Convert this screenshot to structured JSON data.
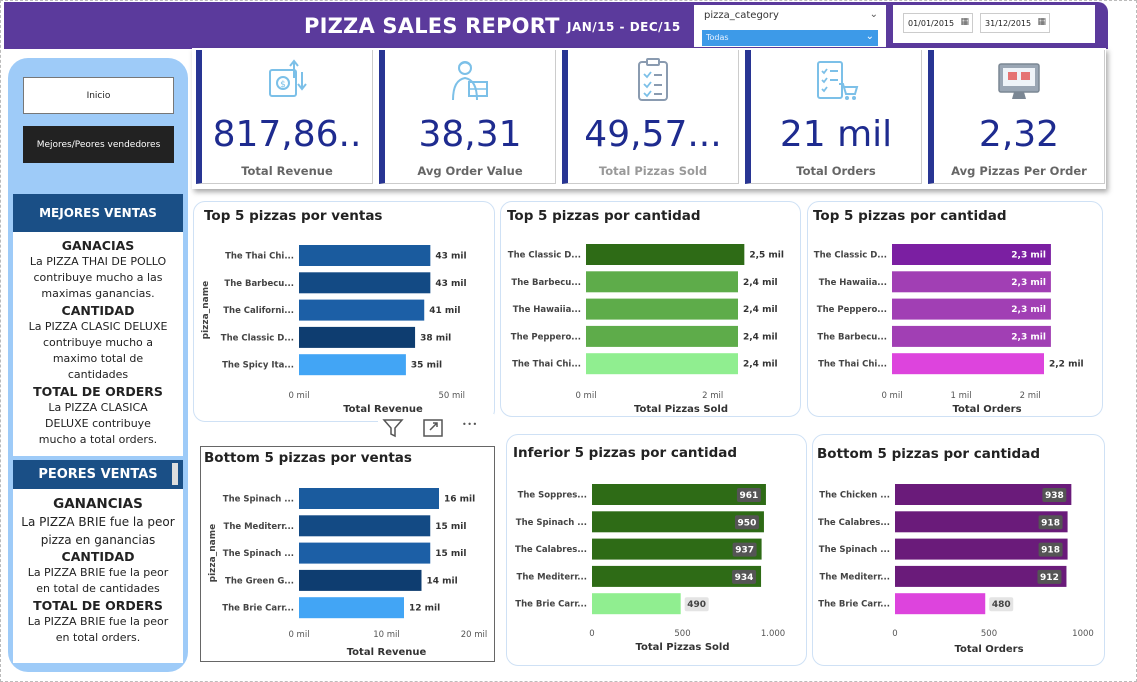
{
  "header": {
    "title": "PIZZA SALES REPORT",
    "period": "JAN/15  -  DEC/15",
    "category_slicer": {
      "label": "pizza_category",
      "selected": "Todas"
    },
    "date_range": {
      "start": "01/01/2015",
      "end": "31/12/2015"
    }
  },
  "sidebar": {
    "buttons": {
      "inicio": "Inicio",
      "mejores": "Mejores/Peores vendedores"
    },
    "mejores": {
      "heading": "MEJORES VENTAS",
      "ganancias_h": "GANACIAS",
      "ganancias_t": "La PIZZA THAI DE POLLO contribuye mucho a las maximas ganancias.",
      "cantidad_h": "CANTIDAD",
      "cantidad_t": "La PIZZA CLASIC DELUXE contribuye mucho a maximo total de cantidades",
      "orders_h": "TOTAL DE ORDERS",
      "orders_t": "La PIZZA CLASICA DELUXE contribuye mucho a total orders."
    },
    "peores": {
      "heading": "PEORES VENTAS",
      "ganancias_h": "GANANCIAS",
      "ganancias_t": "La PIZZA BRIE fue la peor pizza en ganancias",
      "cantidad_h": "CANTIDAD",
      "cantidad_t": "La PIZZA BRIE fue la peor en total de cantidades",
      "orders_h": "TOTAL DE ORDERS",
      "orders_t": "La PIZZA BRIE fue la peor en total orders."
    }
  },
  "kpis": [
    {
      "value": "817,86..",
      "label": "Total Revenue",
      "icon": "money-transfer-icon"
    },
    {
      "value": "38,31",
      "label": "Avg Order Value",
      "icon": "delivery-person-icon"
    },
    {
      "value": "49,57...",
      "label": "Total Pizzas Sold",
      "icon": "clipboard-checklist-icon"
    },
    {
      "value": "21 mil",
      "label": "Total Orders",
      "icon": "checklist-cart-icon"
    },
    {
      "value": "2,32",
      "label": "Avg Pizzas Per Order",
      "icon": "monitor-cart-icon"
    }
  ],
  "toolbar": {
    "icons": [
      "filter-icon",
      "focus-mode-icon",
      "more-options-icon"
    ],
    "more": "• • •"
  },
  "colors": {
    "header": "#5b3a9c",
    "sidebar": "#9ecbf8",
    "side_head": "#1a4f86",
    "kpi_value": "#1e2b8f",
    "kpi_border": "#283593"
  },
  "chart_data": [
    {
      "id": "top-revenue",
      "type": "bar",
      "title": "Top 5 pizzas por ventas",
      "categories": [
        "The Thai Chi...",
        "The Barbecu...",
        "The Californi...",
        "The Classic D...",
        "The Spicy Ita..."
      ],
      "values": [
        43,
        43,
        41,
        38,
        35
      ],
      "labels": [
        "43 mil",
        "43 mil",
        "41 mil",
        "38 mil",
        "35 mil"
      ],
      "colors": [
        "#1a5b9e",
        "#134a84",
        "#1c5fa6",
        "#0e3d70",
        "#42a5f5"
      ],
      "xlabel": "Total Revenue",
      "ylabel": "pizza_name",
      "xlim": [
        0,
        55
      ],
      "ticks": [
        0,
        50
      ],
      "tick_labels": [
        "0 mil",
        "50 mil"
      ],
      "label_style": "outside"
    },
    {
      "id": "top-qty",
      "type": "bar",
      "title": "Top 5 pizzas por cantidad",
      "categories": [
        "The Classic D...",
        "The Barbecu...",
        "The Hawaiia...",
        "The Peppero...",
        "The Thai Chi..."
      ],
      "values": [
        2.5,
        2.4,
        2.4,
        2.4,
        2.4
      ],
      "labels": [
        "2,5 mil",
        "2,4 mil",
        "2,4 mil",
        "2,4 mil",
        "2,4 mil"
      ],
      "colors": [
        "#2e6b16",
        "#5eac4a",
        "#5eac4a",
        "#5eac4a",
        "#90ee90"
      ],
      "xlabel": "Total Pizzas Sold",
      "ylabel": "",
      "xlim": [
        0,
        3.0
      ],
      "ticks": [
        0,
        2
      ],
      "tick_labels": [
        "0 mil",
        "2 mil"
      ],
      "label_style": "outside"
    },
    {
      "id": "top-orders",
      "type": "bar",
      "title": "Top 5 pizzas por cantidad",
      "categories": [
        "The Classic D...",
        "The Hawaiia...",
        "The Peppero...",
        "The Barbecu...",
        "The Thai Chi..."
      ],
      "values": [
        2.3,
        2.3,
        2.3,
        2.3,
        2.2
      ],
      "labels": [
        "2,3 mil",
        "2,3 mil",
        "2,3 mil",
        "2,3 mil",
        "2,2 mil"
      ],
      "colors": [
        "#7b1fa2",
        "#a13fb4",
        "#a13fb4",
        "#a13fb4",
        "#dd44dd"
      ],
      "xlabel": "Total Orders",
      "ylabel": "",
      "xlim": [
        0,
        2.75
      ],
      "ticks": [
        0,
        1,
        2
      ],
      "tick_labels": [
        "0 mil",
        "1 mil",
        "2 mil"
      ],
      "label_style": "inside-end-last-outside"
    },
    {
      "id": "bottom-revenue",
      "type": "bar",
      "title": "Bottom 5 pizzas por ventas",
      "categories": [
        "The Spinach ...",
        "The Mediterr...",
        "The Spinach ...",
        "The Green G...",
        "The Brie Carr..."
      ],
      "values": [
        16,
        15,
        15,
        14,
        12
      ],
      "labels": [
        "16 mil",
        "15 mil",
        "15 mil",
        "14 mil",
        "12 mil"
      ],
      "colors": [
        "#1a5b9e",
        "#134a84",
        "#1c5fa6",
        "#0e3d70",
        "#42a5f5"
      ],
      "xlabel": "Total Revenue",
      "ylabel": "pizza_name",
      "xlim": [
        0,
        20
      ],
      "ticks": [
        0,
        10,
        20
      ],
      "tick_labels": [
        "0 mil",
        "10 mil",
        "20 mil"
      ],
      "label_style": "outside"
    },
    {
      "id": "bottom-qty",
      "type": "bar",
      "title": "Inferior 5 pizzas por cantidad",
      "categories": [
        "The Soppres...",
        "The Spinach ...",
        "The Calabres...",
        "The Mediterr...",
        "The Brie Carr..."
      ],
      "values": [
        961,
        950,
        937,
        934,
        490
      ],
      "labels": [
        "961",
        "950",
        "937",
        "934",
        "490"
      ],
      "colors": [
        "#2e6b16",
        "#2e6b16",
        "#2e6b16",
        "#2e6b16",
        "#90ee90"
      ],
      "xlabel": "Total Pizzas Sold",
      "ylabel": "",
      "xlim": [
        0,
        1000
      ],
      "ticks": [
        0,
        500,
        1000
      ],
      "tick_labels": [
        "0",
        "500",
        "1.000"
      ],
      "label_style": "badge"
    },
    {
      "id": "bottom-orders",
      "type": "bar",
      "title": "Bottom 5 pizzas por cantidad",
      "categories": [
        "The Chicken ...",
        "The Calabres...",
        "The Spinach ...",
        "The Mediterr...",
        "The Brie Carr..."
      ],
      "values": [
        938,
        918,
        918,
        912,
        480
      ],
      "labels": [
        "938",
        "918",
        "918",
        "912",
        "480"
      ],
      "colors": [
        "#6a1b7a",
        "#6a1b7a",
        "#6a1b7a",
        "#6a1b7a",
        "#dd44dd"
      ],
      "xlabel": "Total Orders",
      "ylabel": "",
      "xlim": [
        0,
        1000
      ],
      "ticks": [
        0,
        500,
        1000
      ],
      "tick_labels": [
        "0",
        "500",
        "1000"
      ],
      "label_style": "badge"
    }
  ]
}
